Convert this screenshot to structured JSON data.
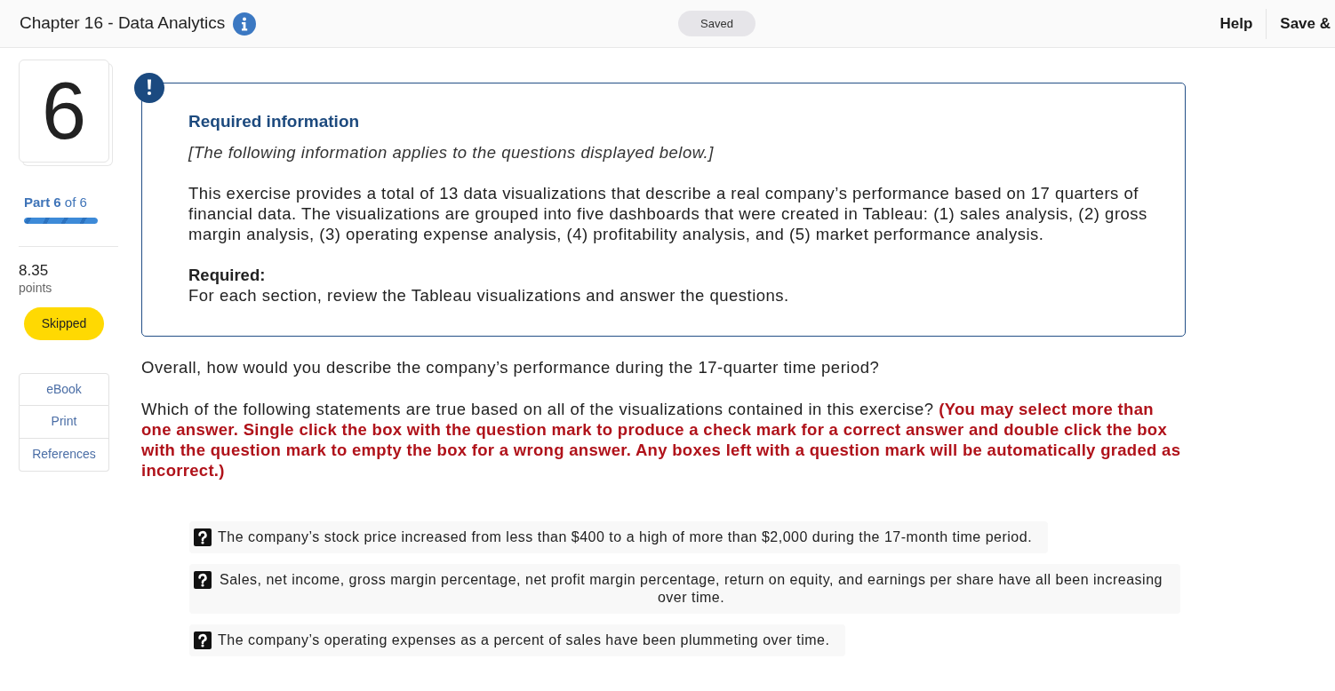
{
  "header": {
    "title": "Chapter 16 - Data Analytics",
    "save_status": "Saved",
    "actions": [
      "Help",
      "Save &"
    ]
  },
  "sidebar": {
    "question_number": "6",
    "part": "**Part 6** of 6",
    "progress": {
      "level": 1
    },
    "score": "8.35",
    "score_unit": "points",
    "status": "Skipped",
    "links": [
      "eBook",
      "Print",
      "References"
    ]
  },
  "info_box": {
    "title": "Required information",
    "note": "[The following information applies to the questions displayed below.]",
    "body": "This exercise provides a total of 13 data visualizations that describe a real company’s performance based on 17 quarters of financial data. The visualizations are grouped into five dashboards that were created in Tableau: (1) sales analysis, (2) gross margin analysis, (3) operating expense analysis, (4) profitability analysis, and (5) market performance analysis.",
    "required_label": "Required:",
    "required_text": "For each section, review the Tableau visualizations and answer the questions."
  },
  "question": {
    "prompt": "Overall, how would you describe the company’s performance during the 17-quarter time period?",
    "instruction": "Which of the following statements are true based on all of the visualizations contained in this exercise? **(You may select more than one answer. Single click the box with the question mark to produce a check mark for a correct answer and double click the box with the question mark to empty the box for a wrong answer. Any boxes left with a question mark will be automatically graded as incorrect.)**"
  },
  "options": [
    {
      "text": "The company’s stock price increased from less than $400 to a high of more than $2,000 during the 17-month time period.",
      "answered": false
    },
    {
      "text": "Sales, net income, gross margin percentage, net profit margin percentage, return on equity, and earnings per share have all been increasing over time.",
      "answered": false
    },
    {
      "text": "The company’s operating expenses as a percent of sales have been plummeting over time.",
      "answered": false
    }
  ]
}
